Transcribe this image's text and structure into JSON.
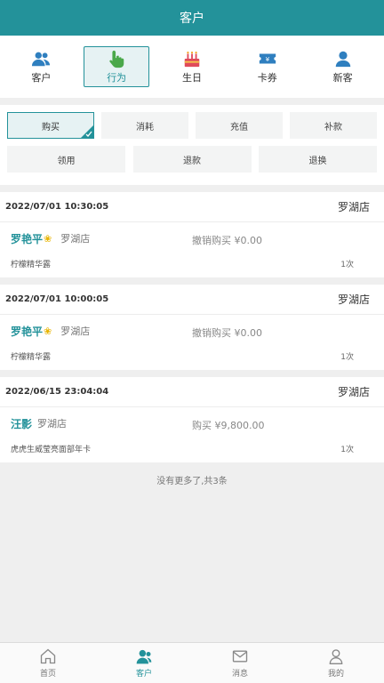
{
  "header": {
    "title": "客户"
  },
  "categories": [
    {
      "label": "客户",
      "icon": "customers-icon"
    },
    {
      "label": "行为",
      "icon": "pointer-hand-icon",
      "active": true
    },
    {
      "label": "生日",
      "icon": "birthday-cake-icon"
    },
    {
      "label": "卡券",
      "icon": "ticket-icon"
    },
    {
      "label": "新客",
      "icon": "new-customer-icon"
    }
  ],
  "filters": {
    "row1": [
      "购买",
      "消耗",
      "充值",
      "补款"
    ],
    "row2": [
      "领用",
      "退款",
      "退换"
    ],
    "active": "购买"
  },
  "records": [
    {
      "datetime": "2022/07/01 10:30:05",
      "store": "罗湖店",
      "customer": "罗艳平",
      "customer_store": "罗湖店",
      "action": "撤销购买 ¥0.00",
      "product": "柠檬精华露",
      "count": "1次",
      "flower": "❀"
    },
    {
      "datetime": "2022/07/01 10:00:05",
      "store": "罗湖店",
      "customer": "罗艳平",
      "customer_store": "罗湖店",
      "action": "撤销购买 ¥0.00",
      "product": "柠檬精华露",
      "count": "1次",
      "flower": "❀"
    },
    {
      "datetime": "2022/06/15 23:04:04",
      "store": "罗湖店",
      "customer": "汪影",
      "customer_store": "罗湖店",
      "action": "购买 ¥9,800.00",
      "product": "虎虎生威莹亮面部年卡",
      "count": "1次",
      "flower": ""
    }
  ],
  "footer_note": "没有更多了,共3条",
  "tabbar": [
    {
      "label": "首页",
      "icon": "home-icon"
    },
    {
      "label": "客户",
      "icon": "customer-icon",
      "active": true
    },
    {
      "label": "消息",
      "icon": "mail-icon"
    },
    {
      "label": "我的",
      "icon": "profile-icon"
    }
  ],
  "colors": {
    "accent": "#23929a"
  }
}
